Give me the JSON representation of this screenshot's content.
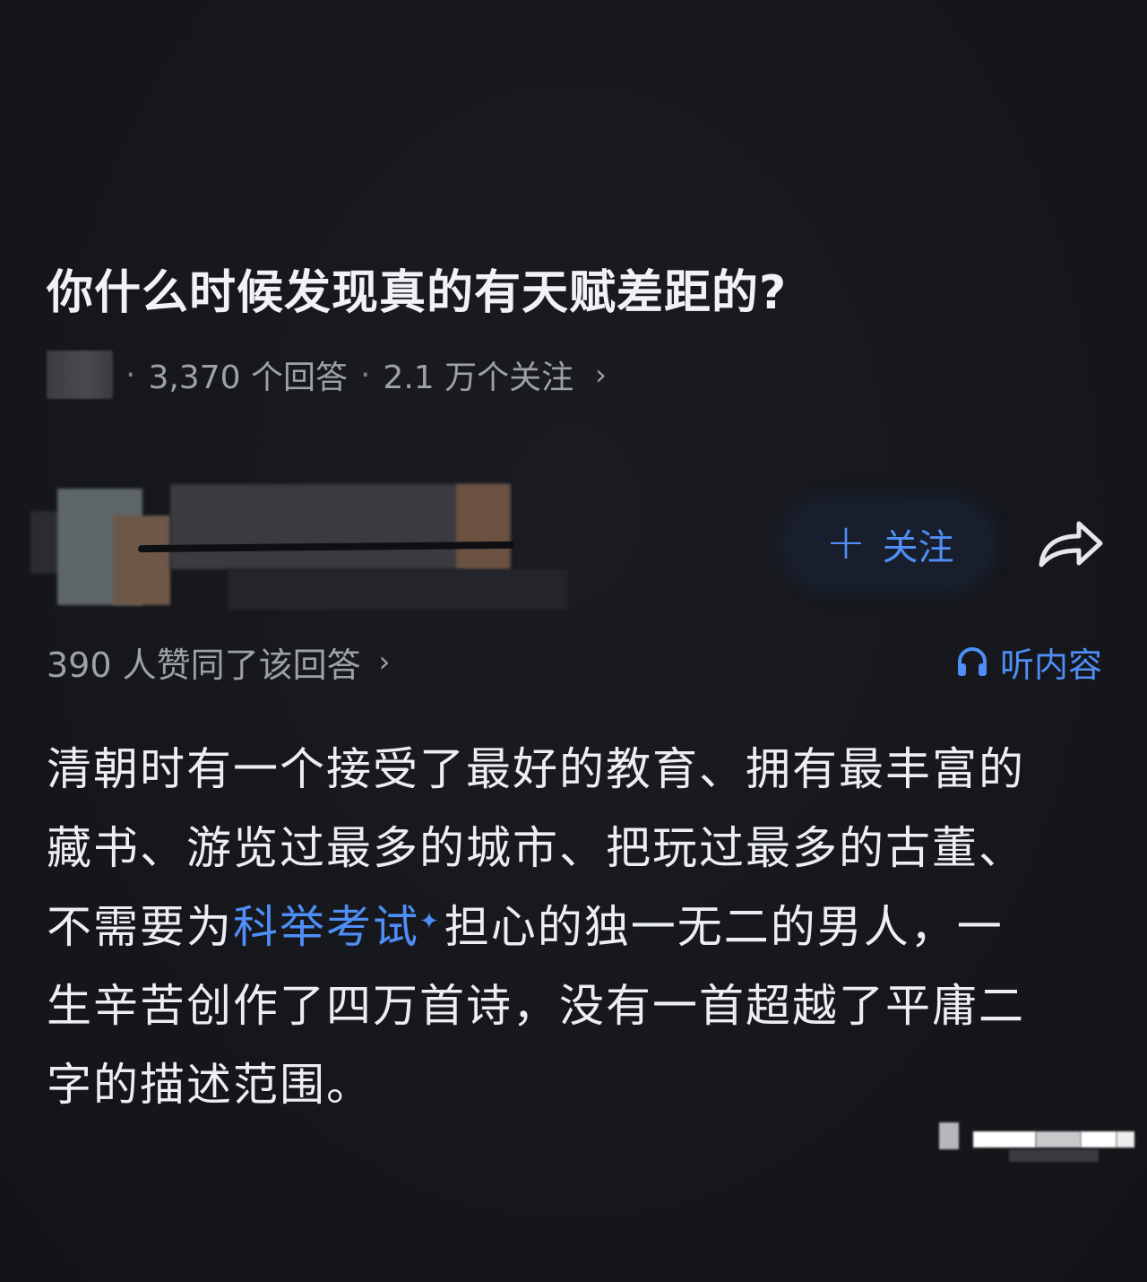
{
  "question": {
    "title": "你什么时候发现真的有天赋差距的?",
    "answers_count": "3,370 个回答",
    "separator": "·",
    "followers_count": "2.1 万个关注",
    "chevron": "›"
  },
  "author": {
    "follow_button_label": "关注",
    "follow_icon": "plus-icon",
    "share_icon": "share-icon"
  },
  "answer": {
    "approval_text": "390 人赞同了该回答",
    "approval_chevron": "›",
    "listen_label": "听内容",
    "listen_icon": "headphone-icon",
    "lines": [
      "清朝时有一个接受了最好的教育、拥有最丰富的",
      "藏书、游览过最多的城市、把玩过最多的古董、"
    ],
    "line3_before": "不需要为",
    "line3_link": "科举考试",
    "line3_after": "担心的独一无二的男人，一",
    "line4": "生辛苦创作了四万首诗，没有一首超越了平庸二",
    "line5": "字的描述范围。"
  },
  "colors": {
    "background": "#15171c",
    "accent_blue": "#4f8ef7",
    "text_primary": "#eceef1",
    "text_secondary": "#9ea1a8"
  }
}
